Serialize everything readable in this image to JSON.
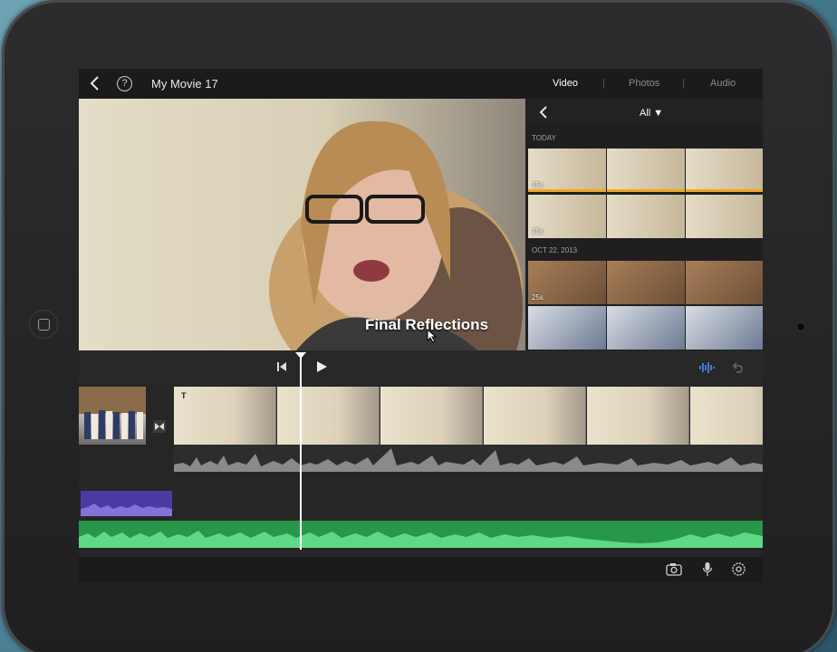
{
  "topbar": {
    "project_title": "My Movie 17",
    "help_label": "?",
    "tabs": [
      {
        "label": "Video",
        "active": true
      },
      {
        "label": "Photos",
        "active": false
      },
      {
        "label": "Audio",
        "active": false
      }
    ],
    "tab_divider": "|"
  },
  "preview": {
    "title_overlay": "Final Reflections"
  },
  "browser": {
    "filter_label": "All ▼",
    "sections": [
      {
        "label": "TODAY",
        "thumbs": [
          {
            "duration": "25s"
          },
          {},
          {},
          {
            "duration": "25s"
          },
          {},
          {}
        ]
      },
      {
        "label": "OCT 22, 2013",
        "thumbs": [
          {
            "duration": "25s"
          },
          {},
          {},
          {},
          {},
          {}
        ]
      }
    ]
  },
  "timeline": {
    "title_marker": "T"
  },
  "icons": {
    "back": "chevron-left-icon",
    "help": "help-circle-icon",
    "skip_back": "skip-to-start-icon",
    "play": "play-icon",
    "waveform": "audio-waveform-icon",
    "undo": "undo-icon",
    "transition": "transition-icon",
    "camera": "camera-icon",
    "mic": "microphone-icon",
    "settings": "settings-gear-icon"
  },
  "colors": {
    "accent_selected": "#f0a623",
    "audio_green": "#27974a",
    "audio_purple": "#4c3aa3",
    "waveform_blue": "#4d8dff"
  }
}
